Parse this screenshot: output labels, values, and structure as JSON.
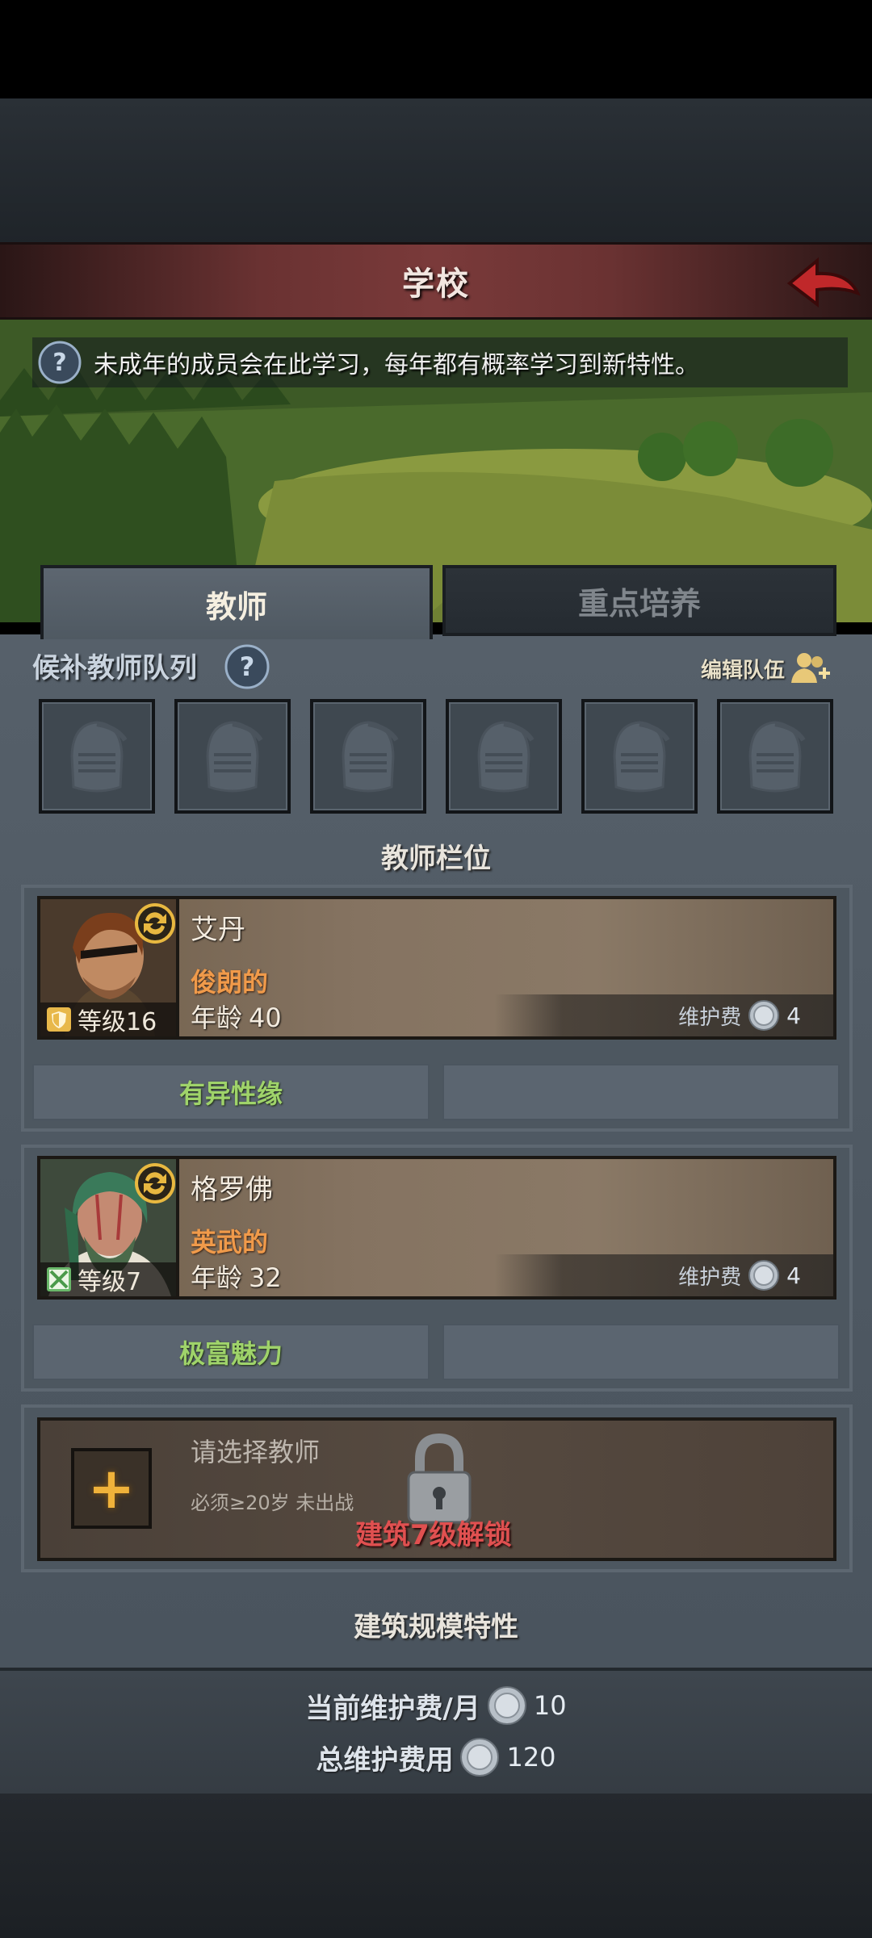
{
  "header": {
    "title": "学校"
  },
  "info": {
    "text": "未成年的成员会在此学习，每年都有概率学习到新特性。"
  },
  "tabs": [
    {
      "label": "教师"
    },
    {
      "label": "重点培养"
    }
  ],
  "queue": {
    "label": "候补教师队列",
    "edit_label": "编辑队伍",
    "slot_count": 6
  },
  "teacher_section": {
    "title": "教师栏位"
  },
  "teachers": [
    {
      "name": "艾丹",
      "level_label": "等级16",
      "trait": "俊朗的",
      "age_label": "年龄",
      "age": "40",
      "fee_label": "维护费",
      "fee": "4",
      "perk": "有异性缘"
    },
    {
      "name": "格罗佛",
      "level_label": "等级7",
      "trait": "英武的",
      "age_label": "年龄",
      "age": "32",
      "fee_label": "维护费",
      "fee": "4",
      "perk": "极富魅力"
    }
  ],
  "locked_slot": {
    "title": "请选择教师",
    "requirement": "必须≥20岁 未出战",
    "unlock_text": "建筑7级解锁"
  },
  "building_section": {
    "title": "建筑规模特性"
  },
  "footer": {
    "monthly_label": "当前维护费/月",
    "monthly_value": "10",
    "total_label": "总维护费用",
    "total_value": "120"
  },
  "colors": {
    "accent_title": "#7a3a3a",
    "trait": "#f09a4a",
    "perk": "#9fd36a",
    "unlock": "#e05050"
  }
}
